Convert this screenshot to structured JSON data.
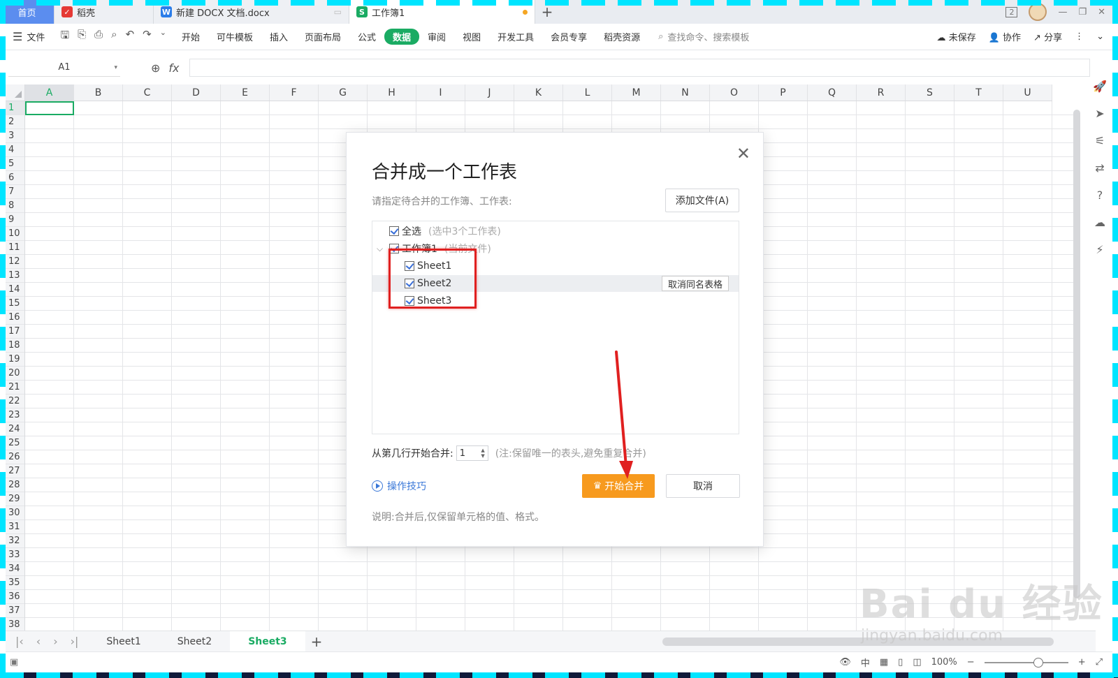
{
  "tabs": {
    "home": "首页",
    "daoke": "稻壳",
    "docx": "新建 DOCX 文档.docx",
    "book": "工作簿1",
    "badge": "2"
  },
  "ribbon": {
    "file": "文件",
    "items": [
      "开始",
      "可牛模板",
      "插入",
      "页面布局",
      "公式",
      "数据",
      "审阅",
      "视图",
      "开发工具",
      "会员专享",
      "稻壳资源"
    ],
    "active": "数据",
    "search_placeholder": "查找命令、搜索模板",
    "unsaved": "未保存",
    "collab": "协作",
    "share": "分享"
  },
  "formula_bar": {
    "cell_ref": "A1",
    "fx": "fx"
  },
  "grid": {
    "columns": [
      "A",
      "B",
      "C",
      "D",
      "E",
      "F",
      "G",
      "H",
      "I",
      "J",
      "K",
      "L",
      "M",
      "N",
      "O",
      "P",
      "Q",
      "R",
      "S",
      "T",
      "U"
    ],
    "rows": [
      "1",
      "2",
      "3",
      "4",
      "5",
      "6",
      "7",
      "8",
      "9",
      "10",
      "11",
      "12",
      "13",
      "14",
      "15",
      "16",
      "17",
      "18",
      "19",
      "20",
      "21",
      "22",
      "23",
      "24",
      "25",
      "26",
      "27",
      "28",
      "29",
      "30",
      "31",
      "32",
      "33",
      "34",
      "35",
      "36",
      "37",
      "38"
    ],
    "selected_col": "A",
    "selected_row": "1"
  },
  "sheets": {
    "tabs": [
      "Sheet1",
      "Sheet2",
      "Sheet3"
    ],
    "active": "Sheet3"
  },
  "status": {
    "zoom": "100%",
    "input_mode": "中"
  },
  "dialog": {
    "title": "合并成一个工作表",
    "prompt": "请指定待合并的工作簿、工作表:",
    "add_file": "添加文件(A)",
    "select_all": "全选",
    "select_all_note": "(选中3个工作表)",
    "workbook": "工作簿1",
    "workbook_note": "(当前文件)",
    "sheets": [
      "Sheet1",
      "Sheet2",
      "Sheet3"
    ],
    "cancel_same_name": "取消同名表格",
    "start_row_label": "从第几行开始合并:",
    "start_row_value": "1",
    "start_row_note": "(注:保留唯一的表头,避免重复合并)",
    "tips": "操作技巧",
    "start_button": "开始合并",
    "cancel_button": "取消",
    "footnote": "说明:合并后,仅保留单元格的值、格式。"
  },
  "watermark": {
    "main": "Bai du 经验",
    "sub": "jingyan.baidu.com"
  }
}
